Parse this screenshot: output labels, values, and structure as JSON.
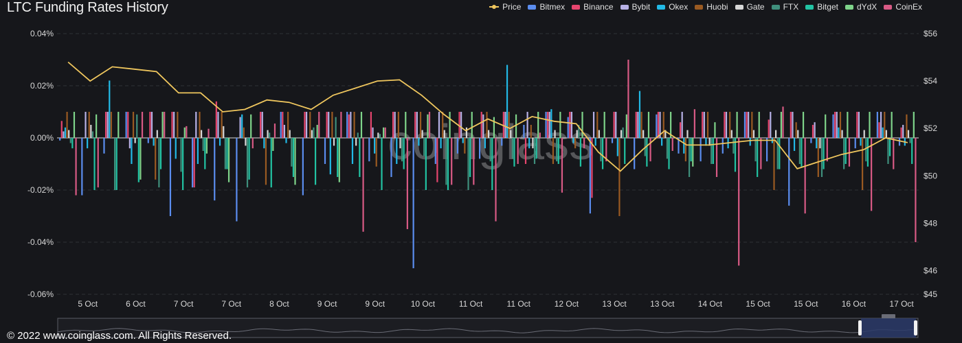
{
  "chart_data": {
    "type": "bar",
    "title": "LTC Funding Rates History",
    "watermark": "coinglass",
    "footer": "© 2022 www.coinglass.com. All Rights Reserved.",
    "left_axis": {
      "ticks": [
        "0.04%",
        "0.02%",
        "0.00%",
        "-0.02%",
        "-0.04%",
        "-0.06%"
      ],
      "values": [
        0.04,
        0.02,
        0,
        -0.02,
        -0.04,
        -0.06
      ],
      "ylim": [
        -0.06,
        0.04
      ]
    },
    "right_axis": {
      "ticks": [
        "$56",
        "$54",
        "$52",
        "$50",
        "$48",
        "$46",
        "$45"
      ],
      "values": [
        56,
        54,
        52,
        50,
        48,
        46,
        45
      ],
      "ylim": [
        45,
        56
      ]
    },
    "x_labels": [
      "5 Oct",
      "6 Oct",
      "7 Oct",
      "7 Oct",
      "8 Oct",
      "9 Oct",
      "9 Oct",
      "10 Oct",
      "11 Oct",
      "11 Oct",
      "12 Oct",
      "13 Oct",
      "13 Oct",
      "14 Oct",
      "15 Oct",
      "15 Oct",
      "16 Oct",
      "17 Oct"
    ],
    "series": [
      {
        "name": "Price",
        "color": "#f0c75e",
        "kind": "line"
      },
      {
        "name": "Bitmex",
        "color": "#5b8def",
        "kind": "bar"
      },
      {
        "name": "Binance",
        "color": "#e6456e",
        "kind": "bar"
      },
      {
        "name": "Bybit",
        "color": "#b7b1e6",
        "kind": "bar"
      },
      {
        "name": "Okex",
        "color": "#22b9e6",
        "kind": "bar"
      },
      {
        "name": "Huobi",
        "color": "#9a5a22",
        "kind": "bar"
      },
      {
        "name": "Gate",
        "color": "#d7d7d7",
        "kind": "bar"
      },
      {
        "name": "FTX",
        "color": "#3f8f7c",
        "kind": "bar"
      },
      {
        "name": "Bitget",
        "color": "#22c3a3",
        "kind": "bar"
      },
      {
        "name": "dYdX",
        "color": "#7fd48a",
        "kind": "bar"
      },
      {
        "name": "CoinEx",
        "color": "#d85a85",
        "kind": "bar"
      }
    ],
    "price_values": [
      54.8,
      54.0,
      54.6,
      54.5,
      54.4,
      53.5,
      53.5,
      52.7,
      52.8,
      53.2,
      53.1,
      52.8,
      53.4,
      53.7,
      54.0,
      54.05,
      53.4,
      52.6,
      51.9,
      52.4,
      52.0,
      52.5,
      52.3,
      52.2,
      51.0,
      50.2,
      51.1,
      51.9,
      51.3,
      51.3,
      51.4,
      51.5,
      51.5,
      50.3,
      50.6,
      50.9,
      51.1,
      51.6,
      51.4
    ],
    "bars": [
      {
        "slot": 0,
        "bitmex": -0.001,
        "binance": 0.0065,
        "bybit": 0.0025,
        "okex": 0.004,
        "huobi": 0.01,
        "gate": 0.003,
        "ftx": -0.002,
        "bitget": -0.004,
        "dydx": 0.01,
        "coinex": -0.022
      },
      {
        "slot": 1,
        "bitmex": -0.022,
        "binance": 0.0,
        "bybit": 0.01,
        "okex": -0.004,
        "huobi": 0.01,
        "gate": 0.005,
        "ftx": 0.0025,
        "bitget": -0.02,
        "dydx": 0.009,
        "coinex": -0.019
      },
      {
        "slot": 2,
        "bitmex": -0.006,
        "binance": 0.01,
        "bybit": 0.01,
        "okex": 0.022,
        "huobi": 0.01,
        "gate": 0.0,
        "ftx": -0.02,
        "bitget": -0.02,
        "dydx": 0.01,
        "coinex": 0.0
      },
      {
        "slot": 3,
        "bitmex": 0.01,
        "binance": 0.01,
        "bybit": -0.004,
        "okex": -0.01,
        "huobi": 0.01,
        "gate": -0.002,
        "ftx": 0.009,
        "bitget": -0.017,
        "dydx": -0.016,
        "coinex": 0.01
      },
      {
        "slot": 4,
        "bitmex": -0.002,
        "binance": 0.01,
        "bybit": 0.01,
        "okex": -0.003,
        "huobi": -0.016,
        "gate": 0.003,
        "ftx": -0.019,
        "bitget": -0.012,
        "dydx": 0.01,
        "coinex": 0.01
      },
      {
        "slot": 5,
        "bitmex": -0.03,
        "binance": 0.01,
        "bybit": 0.01,
        "okex": -0.008,
        "huobi": 0.01,
        "gate": 0.0,
        "ftx": -0.013,
        "bitget": -0.02,
        "dydx": 0.004,
        "coinex": 0.0045
      },
      {
        "slot": 6,
        "bitmex": -0.019,
        "binance": -0.019,
        "bybit": 0.01,
        "okex": -0.01,
        "huobi": 0.01,
        "gate": 0.003,
        "ftx": -0.005,
        "bitget": -0.012,
        "dydx": -0.006,
        "coinex": 0.0035
      },
      {
        "slot": 7,
        "bitmex": -0.024,
        "binance": 0.014,
        "bybit": 0.01,
        "okex": -0.003,
        "huobi": 0.01,
        "gate": 0.0045,
        "ftx": -0.012,
        "bitget": -0.012,
        "dydx": -0.017,
        "coinex": 0.0
      },
      {
        "slot": 8,
        "bitmex": -0.032,
        "binance": 0.0,
        "bybit": 0.008,
        "okex": 0.009,
        "huobi": 0.004,
        "gate": -0.003,
        "ftx": -0.019,
        "bitget": -0.016,
        "dydx": 0.009,
        "coinex": -0.004
      },
      {
        "slot": 9,
        "bitmex": 0.0,
        "binance": 0.01,
        "bybit": 0.01,
        "okex": -0.004,
        "huobi": -0.018,
        "gate": 0.003,
        "ftx": 0.002,
        "bitget": -0.019,
        "dydx": -0.005,
        "coinex": 0.0055
      },
      {
        "slot": 10,
        "bitmex": 0.01,
        "binance": 0.01,
        "bybit": 0.005,
        "okex": -0.002,
        "huobi": 0.01,
        "gate": 0.003,
        "ftx": -0.011,
        "bitget": -0.015,
        "dydx": -0.018,
        "coinex": 0.0
      },
      {
        "slot": 11,
        "bitmex": -0.022,
        "binance": 0.01,
        "bybit": 0.01,
        "okex": 0.0,
        "huobi": 0.01,
        "gate": 0.003,
        "ftx": 0.004,
        "bitget": -0.018,
        "dydx": 0.005,
        "coinex": 0.01
      },
      {
        "slot": 12,
        "bitmex": -0.01,
        "binance": 0.01,
        "bybit": 0.01,
        "okex": -0.014,
        "huobi": 0.01,
        "gate": -0.003,
        "ftx": 0.008,
        "bitget": -0.015,
        "dydx": -0.017,
        "coinex": 0.01
      },
      {
        "slot": 13,
        "bitmex": 0.01,
        "binance": 0.009,
        "bybit": 0.01,
        "okex": -0.01,
        "huobi": 0.01,
        "gate": -0.003,
        "ftx": 0.002,
        "bitget": -0.015,
        "dydx": 0.01,
        "coinex": -0.036
      },
      {
        "slot": 14,
        "bitmex": -0.009,
        "binance": 0.01,
        "bybit": 0.004,
        "okex": -0.006,
        "huobi": -0.011,
        "gate": 0.002,
        "ftx": 0.0015,
        "bitget": -0.02,
        "dydx": 0.004,
        "coinex": 0.004
      },
      {
        "slot": 15,
        "bitmex": -0.015,
        "binance": 0.01,
        "bybit": 0.01,
        "okex": -0.01,
        "huobi": 0.01,
        "gate": -0.004,
        "ftx": -0.009,
        "bitget": -0.012,
        "dydx": 0.01,
        "coinex": -0.035
      },
      {
        "slot": 16,
        "bitmex": -0.05,
        "binance": 0.01,
        "bybit": 0.01,
        "okex": -0.003,
        "huobi": 0.01,
        "gate": 0.003,
        "ftx": -0.007,
        "bitget": -0.02,
        "dydx": 0.009,
        "coinex": 0.01
      },
      {
        "slot": 17,
        "bitmex": -0.01,
        "binance": -0.017,
        "bybit": 0.01,
        "okex": -0.004,
        "huobi": 0.01,
        "gate": 0.003,
        "ftx": -0.018,
        "bitget": -0.02,
        "dydx": 0.01,
        "coinex": -0.018
      },
      {
        "slot": 18,
        "bitmex": -0.006,
        "binance": 0.01,
        "bybit": 0.01,
        "okex": -0.002,
        "huobi": -0.006,
        "gate": 0.004,
        "ftx": -0.02,
        "bitget": -0.015,
        "dydx": 0.01,
        "coinex": -0.018
      },
      {
        "slot": 19,
        "bitmex": -0.008,
        "binance": 0.01,
        "bybit": 0.009,
        "okex": -0.004,
        "huobi": 0.01,
        "gate": 0.003,
        "ftx": -0.009,
        "bitget": -0.02,
        "dydx": 0.008,
        "coinex": -0.032
      },
      {
        "slot": 20,
        "bitmex": -0.003,
        "binance": 0.01,
        "bybit": 0.01,
        "okex": 0.028,
        "huobi": 0.01,
        "gate": 0.003,
        "ftx": -0.008,
        "bitget": -0.011,
        "dydx": 0.009,
        "coinex": -0.01
      },
      {
        "slot": 21,
        "bitmex": 0.005,
        "binance": -0.01,
        "bybit": 0.01,
        "okex": -0.004,
        "huobi": 0.005,
        "gate": -0.004,
        "ftx": -0.01,
        "bitget": -0.008,
        "dydx": 0.01,
        "coinex": 0.002
      },
      {
        "slot": 22,
        "bitmex": 0.01,
        "binance": 0.01,
        "bybit": 0.01,
        "okex": 0.011,
        "huobi": -0.01,
        "gate": 0.003,
        "ftx": -0.009,
        "bitget": -0.01,
        "dydx": 0.01,
        "coinex": -0.021
      },
      {
        "slot": 23,
        "bitmex": 0.008,
        "binance": 0.01,
        "bybit": 0.01,
        "okex": -0.002,
        "huobi": -0.004,
        "gate": 0.003,
        "ftx": 0.005,
        "bitget": -0.011,
        "dydx": 0.01,
        "coinex": -0.004
      },
      {
        "slot": 24,
        "bitmex": -0.029,
        "binance": -0.023,
        "bybit": 0.01,
        "okex": -0.003,
        "huobi": 0.01,
        "gate": 0.003,
        "ftx": -0.009,
        "bitget": -0.012,
        "dydx": 0.01,
        "coinex": -0.009
      },
      {
        "slot": 25,
        "bitmex": -0.002,
        "binance": 0.01,
        "bybit": 0.01,
        "okex": -0.007,
        "huobi": -0.03,
        "gate": 0.003,
        "ftx": 0.004,
        "bitget": -0.01,
        "dydx": 0.009,
        "coinex": 0.03
      },
      {
        "slot": 26,
        "bitmex": -0.012,
        "binance": 0.01,
        "bybit": 0.01,
        "okex": 0.018,
        "huobi": 0.01,
        "gate": 0.003,
        "ftx": -0.007,
        "bitget": -0.011,
        "dydx": 0.01,
        "coinex": -0.009
      },
      {
        "slot": 27,
        "bitmex": 0.009,
        "binance": 0.01,
        "bybit": 0.01,
        "okex": -0.003,
        "huobi": 0.01,
        "gate": 0.003,
        "ftx": -0.008,
        "bitget": -0.012,
        "dydx": 0.01,
        "coinex": -0.005
      },
      {
        "slot": 28,
        "bitmex": -0.006,
        "binance": 0.006,
        "bybit": 0.01,
        "okex": -0.006,
        "huobi": -0.009,
        "gate": 0.003,
        "ftx": -0.015,
        "bitget": -0.009,
        "dydx": -0.011,
        "coinex": 0.011
      },
      {
        "slot": 29,
        "bitmex": -0.009,
        "binance": 0.01,
        "bybit": 0.01,
        "okex": -0.003,
        "huobi": 0.01,
        "gate": -0.003,
        "ftx": -0.01,
        "bitget": -0.01,
        "dydx": 0.006,
        "coinex": -0.015
      },
      {
        "slot": 30,
        "bitmex": -0.006,
        "binance": 0.01,
        "bybit": 0.01,
        "okex": -0.004,
        "huobi": 0.01,
        "gate": 0.003,
        "ftx": -0.006,
        "bitget": -0.013,
        "dydx": 0.01,
        "coinex": -0.049
      },
      {
        "slot": 31,
        "bitmex": 0.01,
        "binance": 0.01,
        "bybit": 0.01,
        "okex": -0.003,
        "huobi": 0.01,
        "gate": 0.003,
        "ftx": -0.009,
        "bitget": -0.015,
        "dydx": 0.01,
        "coinex": -0.012
      },
      {
        "slot": 32,
        "bitmex": -0.009,
        "binance": 0.007,
        "bybit": 0.01,
        "okex": -0.002,
        "huobi": -0.02,
        "gate": 0.003,
        "ftx": -0.012,
        "bitget": -0.012,
        "dydx": 0.01,
        "coinex": 0.012
      },
      {
        "slot": 33,
        "bitmex": -0.026,
        "binance": 0.01,
        "bybit": 0.01,
        "okex": -0.005,
        "huobi": 0.006,
        "gate": 0.003,
        "ftx": -0.01,
        "bitget": -0.011,
        "dydx": 0.01,
        "coinex": -0.029
      },
      {
        "slot": 34,
        "bitmex": -0.002,
        "binance": 0.005,
        "bybit": 0.006,
        "okex": -0.004,
        "huobi": -0.015,
        "gate": -0.004,
        "ftx": -0.015,
        "bitget": -0.012,
        "dydx": 0.009,
        "coinex": -0.009
      },
      {
        "slot": 35,
        "bitmex": 0.009,
        "binance": 0.01,
        "bybit": 0.01,
        "okex": 0.004,
        "huobi": 0.01,
        "gate": 0.003,
        "ftx": -0.012,
        "bitget": -0.01,
        "dydx": 0.01,
        "coinex": -0.011
      },
      {
        "slot": 36,
        "bitmex": -0.004,
        "binance": 0.01,
        "bybit": 0.01,
        "okex": -0.003,
        "huobi": -0.02,
        "gate": 0.003,
        "ftx": -0.009,
        "bitget": -0.011,
        "dydx": 0.01,
        "coinex": -0.028
      },
      {
        "slot": 37,
        "bitmex": 0.01,
        "binance": 0.006,
        "bybit": 0.01,
        "okex": 0.004,
        "huobi": 0.01,
        "gate": 0.003,
        "ftx": -0.01,
        "bitget": -0.007,
        "dydx": 0.01,
        "coinex": -0.012
      },
      {
        "slot": 38,
        "bitmex": -0.003,
        "binance": 0.004,
        "bybit": 0.005,
        "okex": -0.003,
        "huobi": 0.009,
        "gate": 0.003,
        "ftx": -0.002,
        "bitget": -0.01,
        "dydx": 0.01,
        "coinex": -0.04
      }
    ]
  }
}
